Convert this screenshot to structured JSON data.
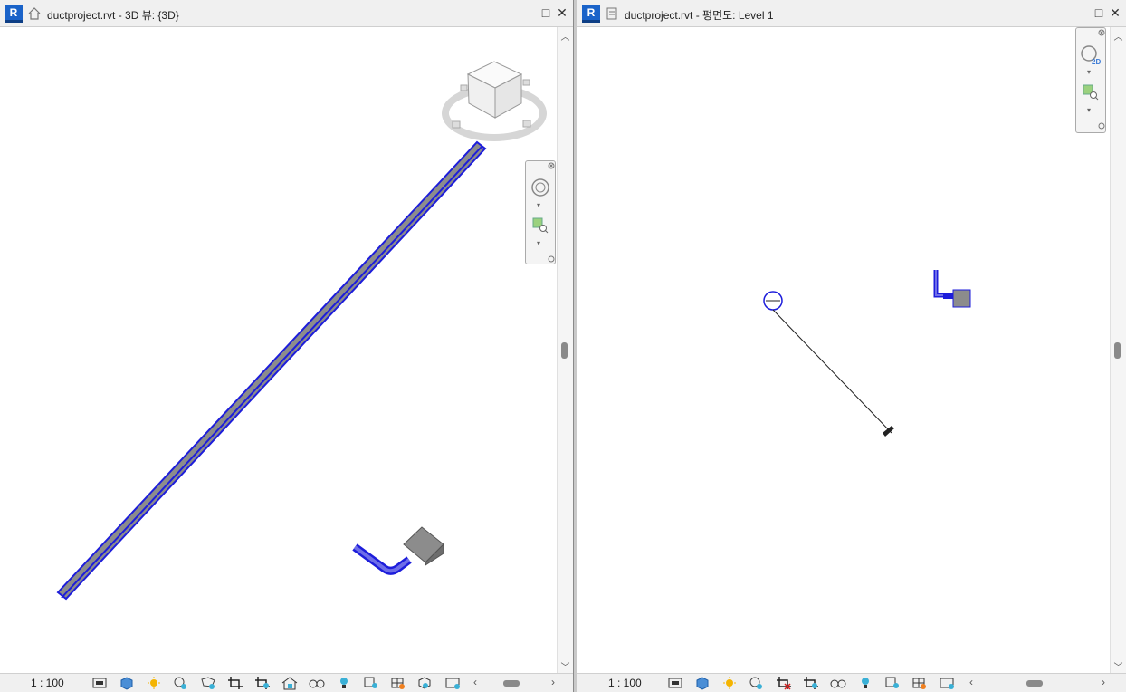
{
  "left_window": {
    "title": "ductproject.rvt - 3D 뷰: {3D}",
    "view_icon": "house-icon",
    "scale": "1 : 100"
  },
  "right_window": {
    "title": "ductproject.rvt - 평면도: Level 1",
    "view_icon": "floor-plan-icon",
    "scale": "1 : 100"
  },
  "window_buttons": {
    "minimize": "–",
    "maximize": "□",
    "close": "✕"
  },
  "app_logo": "R",
  "colors": {
    "duct_blue": "#1d1ddb",
    "duct_gray": "#8c8c8c",
    "revit_blue": "#1a63c9"
  }
}
